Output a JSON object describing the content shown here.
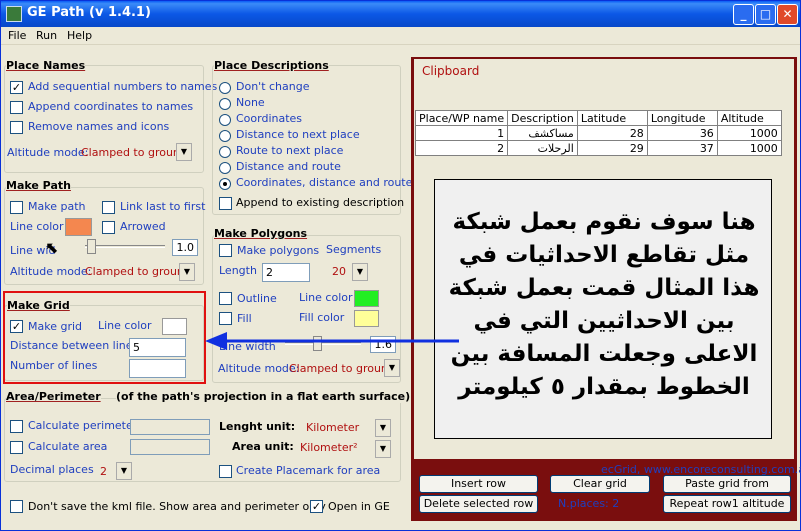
{
  "window": {
    "title": "GE Path (v 1.4.1)"
  },
  "menu": [
    "File",
    "Run",
    "Help"
  ],
  "place_names": {
    "title": "Place Names",
    "add_sequential": {
      "label": "Add sequential numbers to names",
      "checked": true
    },
    "append_coords": {
      "label": "Append coordinates to names",
      "checked": false
    },
    "remove_names": {
      "label": "Remove names and icons",
      "checked": false
    },
    "altitude_label": "Altitude mode:",
    "altitude_value": "Clamped to ground"
  },
  "place_descriptions": {
    "title": "Place Descriptions",
    "options": [
      "Don't change",
      "None",
      "Coordinates",
      "Distance to next place",
      "Route to next place",
      "Distance and route",
      "Coordinates, distance and route"
    ],
    "selected": "Coordinates, distance and route",
    "append_existing": {
      "label": "Append to existing description",
      "checked": false
    }
  },
  "make_path": {
    "title": "Make Path",
    "make_path": {
      "label": "Make path",
      "checked": false
    },
    "link_last": {
      "label": "Link last to first",
      "checked": false
    },
    "line_color_label": "Line color",
    "line_color": "#f4874f",
    "arrowed": {
      "label": "Arrowed",
      "checked": false
    },
    "line_width_label": "Line wid",
    "line_width_value": "1.0",
    "altitude_label": "Altitude mode:",
    "altitude_value": "Clamped to ground"
  },
  "make_polygons": {
    "title": "Make Polygons",
    "make_polygons": {
      "label": "Make polygons",
      "checked": false
    },
    "segments_label": "Segments",
    "length_label": "Length",
    "length_value": "2",
    "segments_value": "20",
    "outline": {
      "label": "Outline",
      "checked": false
    },
    "fill": {
      "label": "Fill",
      "checked": false
    },
    "line_color_label": "Line color",
    "line_color": "#22ee22",
    "fill_color_label": "Fill color",
    "fill_color": "#ffff99",
    "line_width_label": "Line width",
    "line_width_value": "1.6",
    "altitude_label": "Altitude mode:",
    "altitude_value": "Clamped to ground"
  },
  "make_grid": {
    "title": "Make Grid",
    "make_grid": {
      "label": "Make grid",
      "checked": true
    },
    "line_color_label": "Line color",
    "line_color": "#ffffff",
    "distance_label": "Distance between lines",
    "distance_value": "5",
    "number_label": "Number of  lines",
    "number_value": ""
  },
  "area_perimeter": {
    "title": "Area/Perimeter",
    "subtitle": "(of the path's projection in a flat earth surface)",
    "calc_perimeter": {
      "label": "Calculate perimeter",
      "checked": false
    },
    "calc_area": {
      "label": "Calculate area",
      "checked": false
    },
    "length_unit_label": "Lenght unit:",
    "length_unit_value": "Kilometer",
    "area_unit_label": "Area unit:",
    "area_unit_value": "Kilometer²",
    "decimal_label": "Decimal places",
    "decimal_value": "2",
    "create_placemark": {
      "label": "Create Placemark for area",
      "checked": false
    }
  },
  "footer": {
    "dont_save": {
      "label": "Don't save the kml file. Show area and perimeter only",
      "checked": false
    },
    "open_ge": {
      "label": "Open in GE",
      "checked": true
    }
  },
  "clipboard": {
    "title": "Clipboard",
    "columns": [
      "Place/WP name",
      "Description",
      "Latitude",
      "Longitude",
      "Altitude"
    ],
    "rows": [
      [
        "1",
        "مساكشف",
        "28",
        "36",
        "1000"
      ],
      [
        "2",
        "الرحلات",
        "29",
        "37",
        "1000"
      ]
    ],
    "credit": "ecGrid,  www.encoreconsulting.com.au",
    "insert_row": "Insert row",
    "clear_grid": "Clear grid",
    "paste_grid": "Paste grid from clipboard",
    "delete_row": "Delete selected row",
    "n_places": "N.places: 2",
    "repeat_alt": "Repeat row1 altitude"
  },
  "annotation": {
    "text": "هنا سوف نقوم بعمل شبكة مثل تقاطع الاحداثيات في هذا المثال قمت بعمل شبكة بين الاحداثيين التي في الاعلى وجعلت المسافة بين الخطوط بمقدار ٥ كيلومتر"
  }
}
